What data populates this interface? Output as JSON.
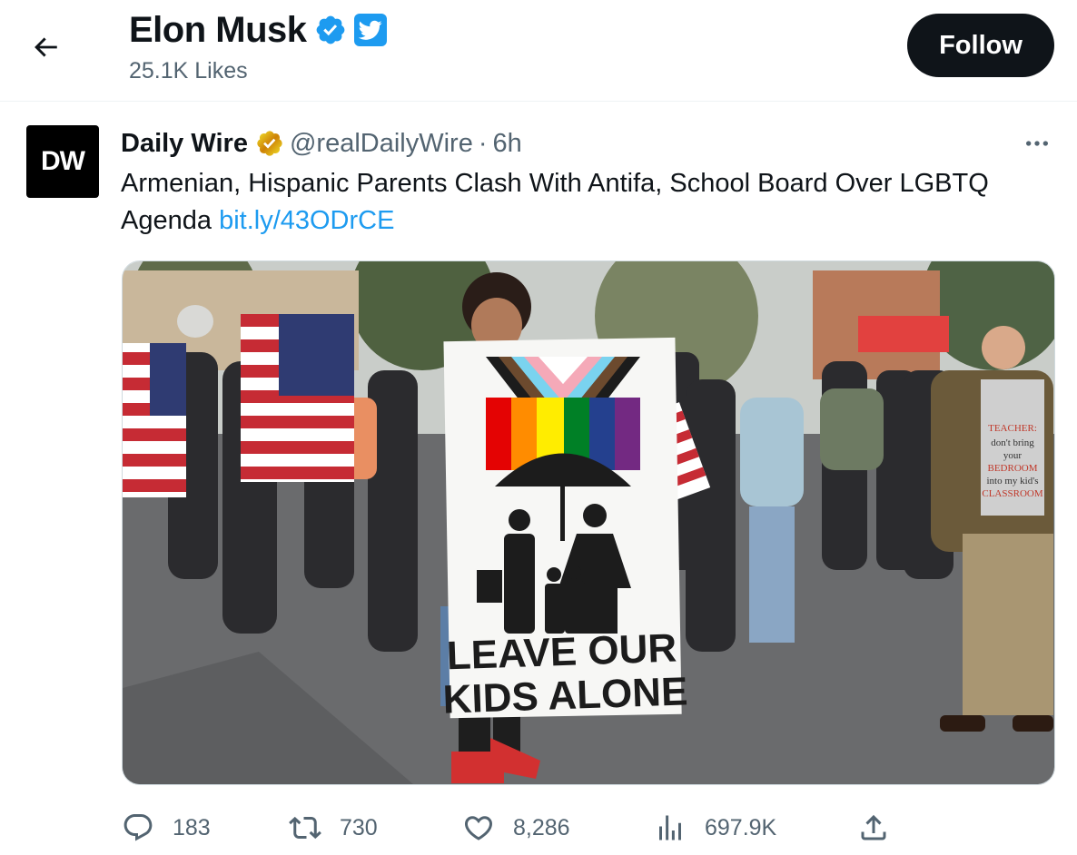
{
  "header": {
    "name": "Elon Musk",
    "subtitle": "25.1K Likes",
    "follow_label": "Follow"
  },
  "tweet": {
    "avatar_text": "DW",
    "author_name": "Daily Wire",
    "handle": "@realDailyWire",
    "separator": "·",
    "time": "6h",
    "text": "Armenian, Hispanic Parents Clash With Antifa, School Board Over LGBTQ Agenda",
    "link": "bit.ly/43ODrCE",
    "media": {
      "sign_line1": "LEAVE OUR",
      "sign_line2": "KIDS ALONE",
      "shirt_lines": [
        "TEACHER:",
        "don't bring",
        "your",
        "BEDROOM",
        "into my kid's",
        "CLASSROOM"
      ]
    }
  },
  "actions": {
    "replies": "183",
    "retweets": "730",
    "likes": "8,286",
    "views": "697.9K"
  },
  "colors": {
    "accent": "#1d9bf0",
    "verified_gold": "#e2b719",
    "text_primary": "#0f1419",
    "text_secondary": "#536471"
  },
  "icons": [
    "back-arrow-icon",
    "verified-badge-icon",
    "twitter-bird-icon",
    "gold-verified-badge-icon",
    "more-options-icon",
    "reply-icon",
    "retweet-icon",
    "like-icon",
    "views-icon",
    "share-icon"
  ]
}
